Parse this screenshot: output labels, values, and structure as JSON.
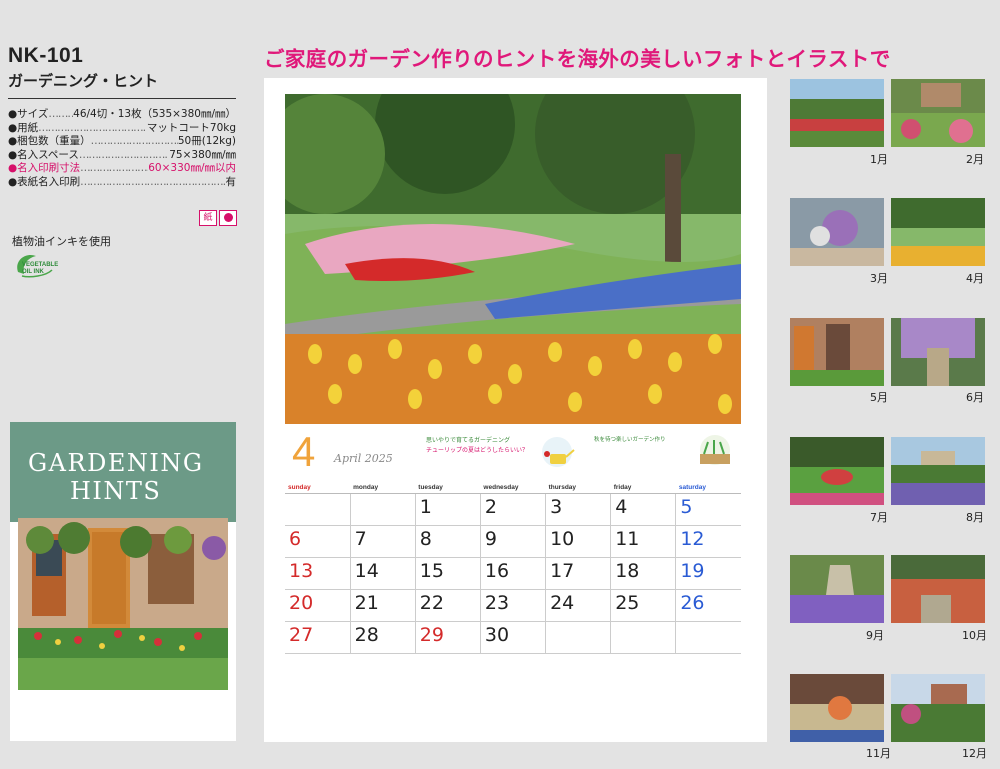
{
  "product": {
    "model": "NK-101",
    "title": "ガーデニング・ヒント"
  },
  "specs": [
    {
      "label": "●サイズ",
      "value": "46/4切・13枚（535×380㎜/㎜）",
      "highlight": false
    },
    {
      "label": "●用紙",
      "value": "マットコート70kg",
      "highlight": false
    },
    {
      "label": "●梱包数（重量）",
      "value": "50冊(12kg)",
      "highlight": false
    },
    {
      "label": "●名入スペース",
      "value": "75×380㎜/㎜",
      "highlight": false
    },
    {
      "label": "●名入印刷寸法",
      "value": "60×330㎜/㎜以内",
      "highlight": true
    },
    {
      "label": "●表紙名入印刷",
      "value": "有",
      "highlight": false
    }
  ],
  "badge": "紙",
  "ink_note": "植物油インキを使用",
  "ink_logo": [
    "VEGETABLE",
    "OIL INK"
  ],
  "cover": {
    "title_line1": "GARDENING",
    "title_line2": "HINTS"
  },
  "headline": "ご家庭のガーデン作りのヒントを海外の美しいフォトとイラストで",
  "calendar": {
    "month_number": "4",
    "month_name": "April 2025",
    "tip_title": "思いやりで育てるガーデニング",
    "tip_subtitle": "チューリップの夏はどうしたらいい？",
    "tip2_title": "秋を待つ楽しいガーデン作り",
    "weekdays": [
      "sunday",
      "monday",
      "tuesday",
      "wednesday",
      "thursday",
      "friday",
      "saturday"
    ],
    "weeks": [
      [
        "",
        "",
        "1",
        "2",
        "3",
        "4",
        "5"
      ],
      [
        "6",
        "7",
        "8",
        "9",
        "10",
        "11",
        "12"
      ],
      [
        "13",
        "14",
        "15",
        "16",
        "17",
        "18",
        "19"
      ],
      [
        "20",
        "21",
        "22",
        "23",
        "24",
        "25",
        "26"
      ],
      [
        "27",
        "28",
        "29",
        "30",
        "",
        "",
        ""
      ]
    ],
    "holidays": [
      "29"
    ]
  },
  "thumbnails": [
    "1月",
    "2月",
    "3月",
    "4月",
    "5月",
    "6月",
    "7月",
    "8月",
    "9月",
    "10月",
    "11月",
    "12月"
  ],
  "colors": {
    "accent_pink": "#e0187a",
    "sunday_red": "#d42a2a",
    "saturday_blue": "#2a5bd4",
    "cover_green": "#6c9a87",
    "month_orange": "#f0a33b"
  }
}
